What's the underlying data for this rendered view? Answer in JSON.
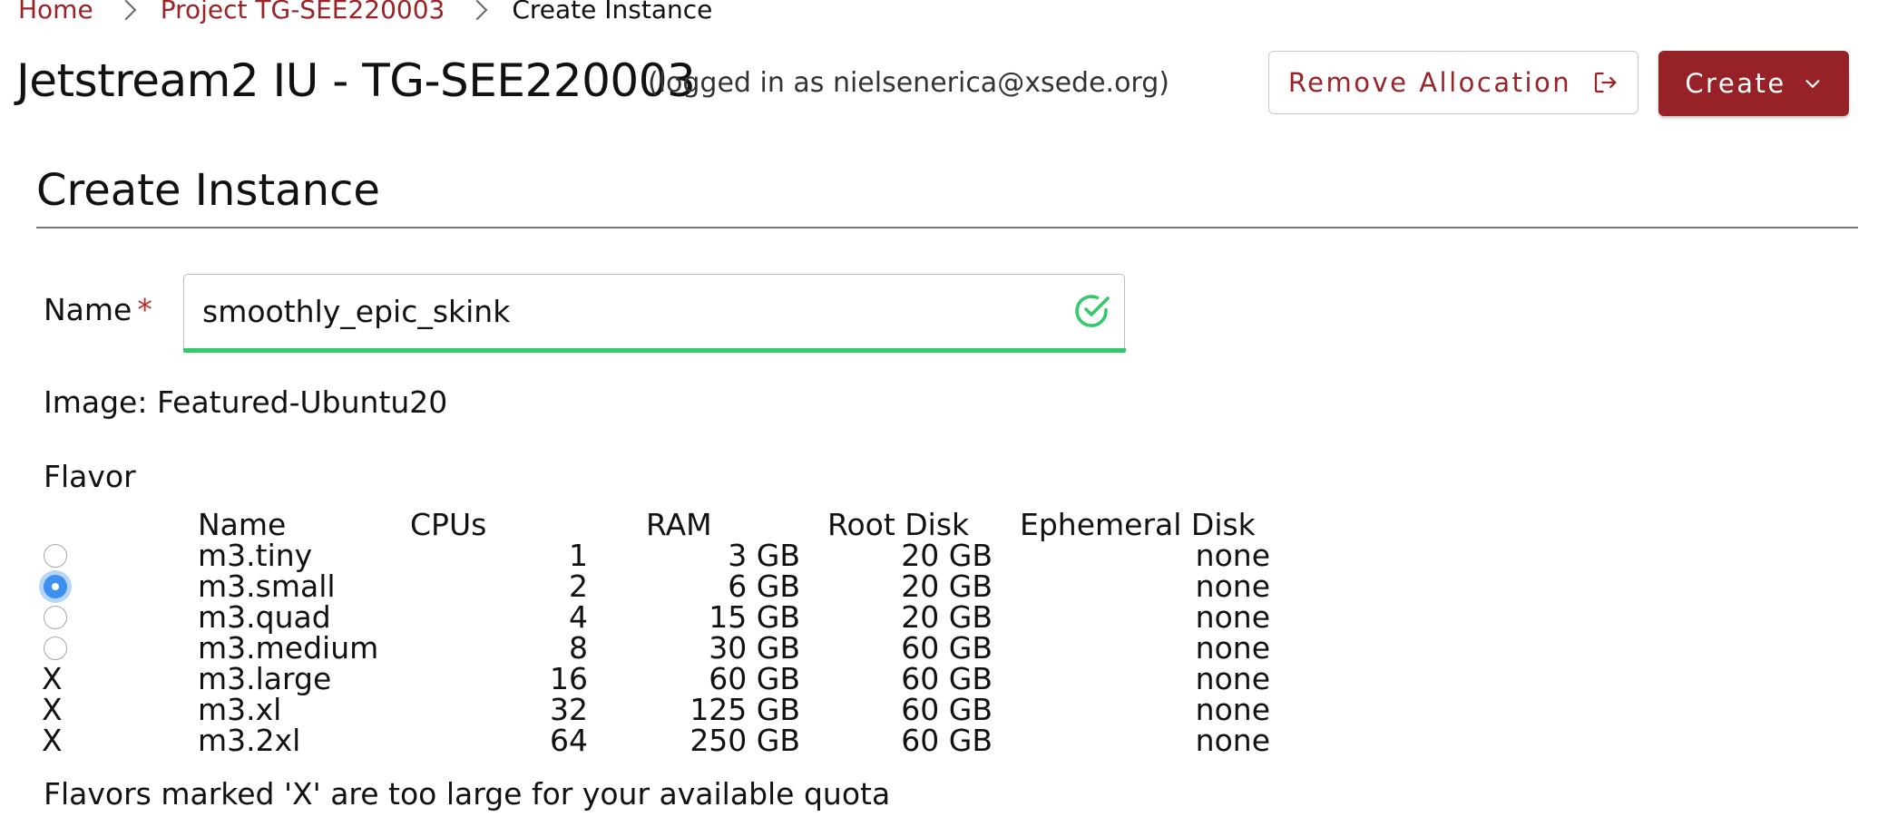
{
  "breadcrumb": {
    "items": [
      {
        "label": "Home"
      },
      {
        "label": "Project TG-SEE220003"
      },
      {
        "label": "Create Instance"
      }
    ]
  },
  "header": {
    "allocation_title": "Jetstream2 IU - TG-SEE220003",
    "logged_in_text": "(logged in as nielsenerica@xsede.org)",
    "remove_allocation_label": "Remove Allocation",
    "remove_allocation_icon": "logout-icon",
    "create_label": "Create",
    "create_icon": "chevron-down-icon"
  },
  "form": {
    "title": "Create Instance",
    "name_label": "Name",
    "required_marker": "*",
    "name_value": "smoothly_epic_skink",
    "name_valid_icon": "check-circle-icon",
    "image_text": "Image: Featured-Ubuntu20",
    "flavor_heading": "Flavor",
    "flavor_columns": [
      "Name",
      "CPUs",
      "RAM",
      "Root Disk",
      "Ephemeral Disk"
    ],
    "flavors": [
      {
        "selector": "radio",
        "selected": false,
        "name": "m3.tiny",
        "cpus": "1",
        "ram": "3 GB",
        "root_disk": "20 GB",
        "ephemeral_disk": "none"
      },
      {
        "selector": "radio",
        "selected": true,
        "name": "m3.small",
        "cpus": "2",
        "ram": "6 GB",
        "root_disk": "20 GB",
        "ephemeral_disk": "none"
      },
      {
        "selector": "radio",
        "selected": false,
        "name": "m3.quad",
        "cpus": "4",
        "ram": "15 GB",
        "root_disk": "20 GB",
        "ephemeral_disk": "none"
      },
      {
        "selector": "radio",
        "selected": false,
        "name": "m3.medium",
        "cpus": "8",
        "ram": "30 GB",
        "root_disk": "60 GB",
        "ephemeral_disk": "none"
      },
      {
        "selector": "X",
        "selected": false,
        "name": "m3.large",
        "cpus": "16",
        "ram": "60 GB",
        "root_disk": "60 GB",
        "ephemeral_disk": "none"
      },
      {
        "selector": "X",
        "selected": false,
        "name": "m3.xl",
        "cpus": "32",
        "ram": "125 GB",
        "root_disk": "60 GB",
        "ephemeral_disk": "none"
      },
      {
        "selector": "X",
        "selected": false,
        "name": "m3.2xl",
        "cpus": "64",
        "ram": "250 GB",
        "root_disk": "60 GB",
        "ephemeral_disk": "none"
      }
    ],
    "quota_note": "Flavors marked 'X' are too large for your available quota"
  },
  "colors": {
    "brand": "#962227",
    "link": "#9b2226",
    "valid": "#34c96a",
    "radio_selected": "#3d8ff0"
  }
}
